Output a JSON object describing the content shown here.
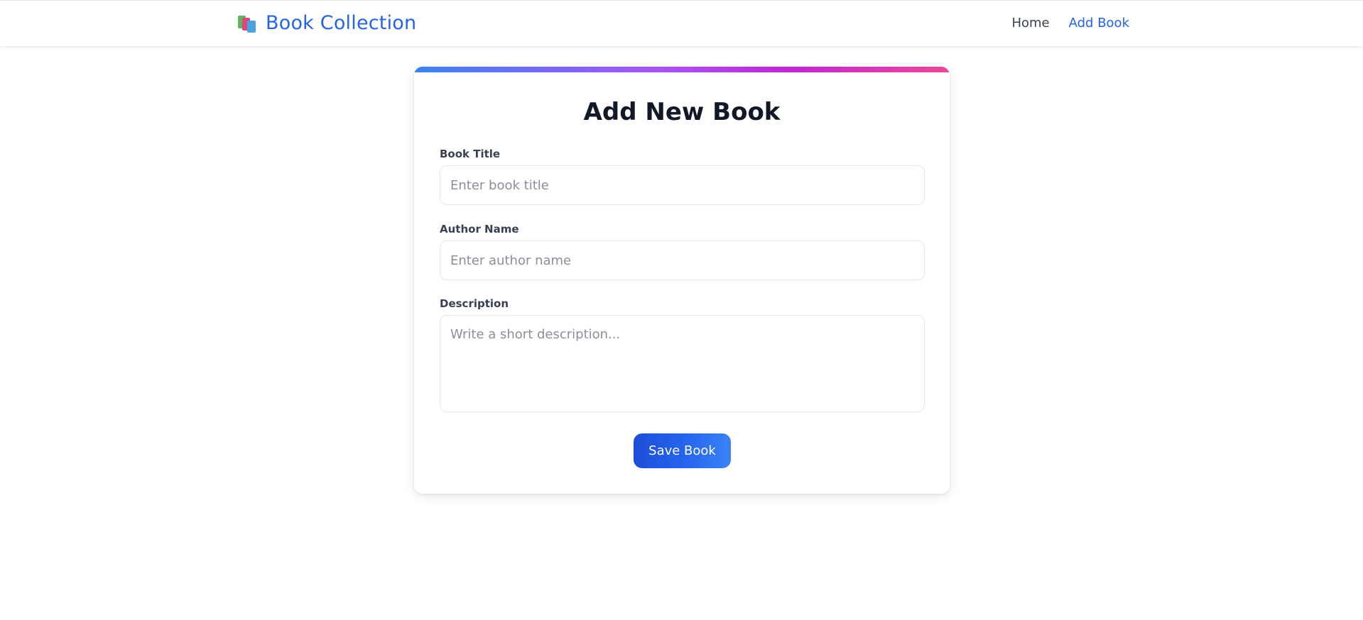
{
  "navbar": {
    "brand_icon": "books-icon",
    "brand_text": "Book Collection",
    "links": [
      {
        "label": "Home",
        "active": false
      },
      {
        "label": "Add Book",
        "active": true
      }
    ],
    "active_color": "#2563eb"
  },
  "form": {
    "title": "Add New Book",
    "fields": {
      "book_title": {
        "label": "Book Title",
        "placeholder": "Enter book title",
        "value": ""
      },
      "author_name": {
        "label": "Author Name",
        "placeholder": "Enter author name",
        "value": ""
      },
      "description": {
        "label": "Description",
        "placeholder": "Write a short description...",
        "value": ""
      }
    },
    "submit_label": "Save Book"
  },
  "colors": {
    "accent_gradient": [
      "#3b82f6",
      "#a855f7",
      "#ec4899"
    ],
    "button": "#2563eb"
  }
}
